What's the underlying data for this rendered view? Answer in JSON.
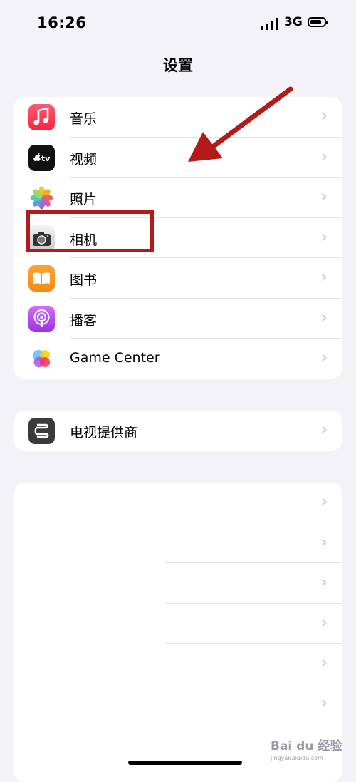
{
  "status_bar": {
    "time": "16:26",
    "network": "3G"
  },
  "nav": {
    "title": "设置"
  },
  "group1": {
    "items": [
      {
        "label": "音乐"
      },
      {
        "label": "视频"
      },
      {
        "label": "照片"
      },
      {
        "label": "相机"
      },
      {
        "label": "图书"
      },
      {
        "label": "播客"
      },
      {
        "label": "Game Center"
      }
    ]
  },
  "group2": {
    "items": [
      {
        "label": "电视提供商"
      }
    ]
  },
  "tv_icon": {
    "text": "tv"
  },
  "watermark": {
    "text": "Bai du 经验",
    "sub": "jingyan.baidu.com"
  },
  "colors": {
    "annotation": "#b51a1a",
    "background": "#f2f2f7"
  }
}
